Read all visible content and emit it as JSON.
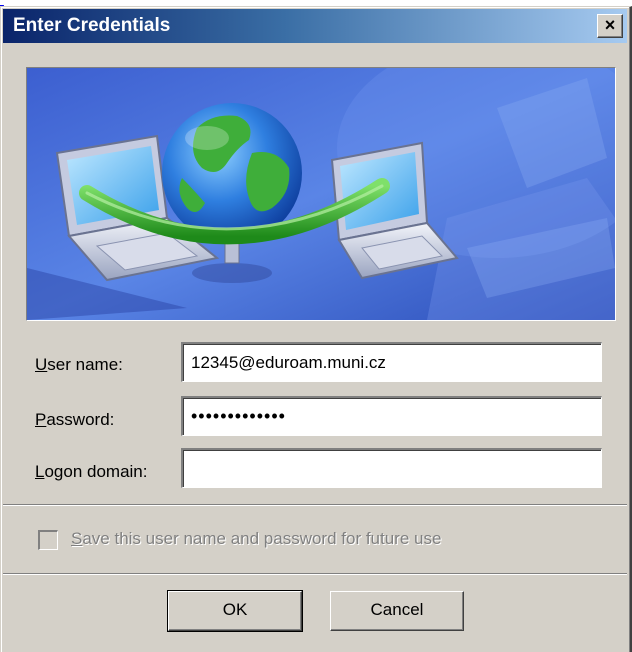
{
  "dialog": {
    "title": "Enter Credentials",
    "close_glyph": "×"
  },
  "form": {
    "username": {
      "label_accel": "U",
      "label_rest": "ser name:",
      "value": "12345@eduroam.muni.cz"
    },
    "password": {
      "label_accel": "P",
      "label_rest": "assword:",
      "value": "•••••••••••••"
    },
    "domain": {
      "label_accel": "L",
      "label_rest": "ogon domain:",
      "value": ""
    }
  },
  "save_option": {
    "label_accel": "S",
    "label_rest": "ave this user name and password for future use",
    "checked": false,
    "enabled": false
  },
  "buttons": {
    "ok_label": "OK",
    "cancel_label": "Cancel"
  },
  "icons": {
    "banner": "network-globe-laptops-illustration",
    "close": "close-icon"
  },
  "colors": {
    "titlebar_start": "#0a246a",
    "titlebar_end": "#a6caf0",
    "dialog_face": "#d4d0c8",
    "banner_blue": "#3a64c8"
  }
}
